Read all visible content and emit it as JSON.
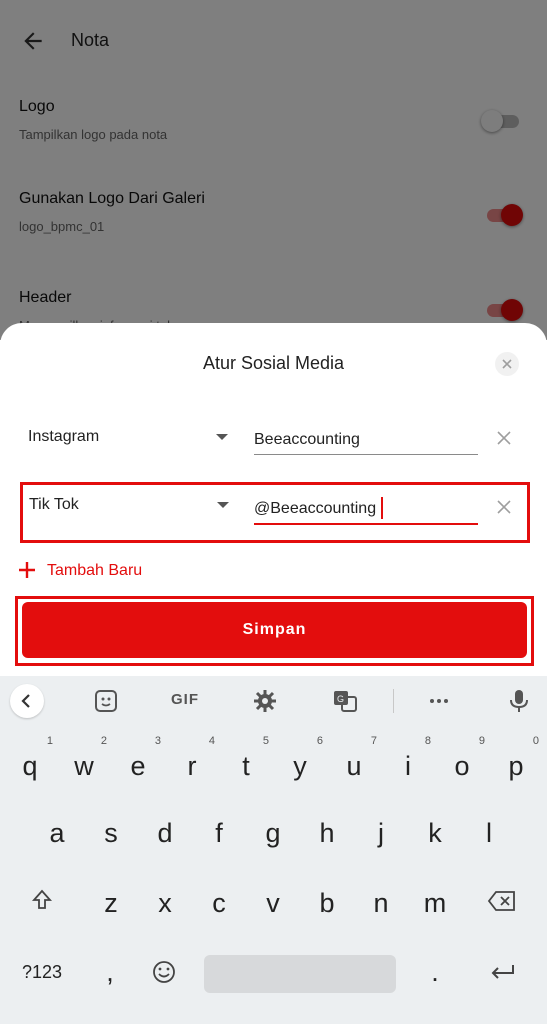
{
  "app": {
    "title": "Nota",
    "settings": [
      {
        "title": "Logo",
        "subtitle": "Tampilkan logo pada nota",
        "enabled": false
      },
      {
        "title": "Gunakan Logo Dari Galeri",
        "subtitle": "logo_bpmc_01",
        "enabled": true
      },
      {
        "title": "Header",
        "subtitle": "Menampilkan informasi toko",
        "enabled": true
      }
    ]
  },
  "sheet": {
    "title": "Atur Sosial Media",
    "rows": [
      {
        "platform": "Instagram",
        "handle": "Beeaccounting"
      },
      {
        "platform": "Tik Tok",
        "handle": "@Beeaccounting"
      }
    ],
    "add_label": "Tambah Baru",
    "save_label": "Simpan"
  },
  "keyboard": {
    "toolbar": [
      "chevron-left-icon",
      "sticker-icon",
      "GIF",
      "gear-icon",
      "translate-icon",
      "more-icon",
      "mic-icon"
    ],
    "gif_label": "GIF",
    "row1": [
      {
        "k": "q",
        "h": "1"
      },
      {
        "k": "w",
        "h": "2"
      },
      {
        "k": "e",
        "h": "3"
      },
      {
        "k": "r",
        "h": "4"
      },
      {
        "k": "t",
        "h": "5"
      },
      {
        "k": "y",
        "h": "6"
      },
      {
        "k": "u",
        "h": "7"
      },
      {
        "k": "i",
        "h": "8"
      },
      {
        "k": "o",
        "h": "9"
      },
      {
        "k": "p",
        "h": "0"
      }
    ],
    "row2": [
      "a",
      "s",
      "d",
      "f",
      "g",
      "h",
      "j",
      "k",
      "l"
    ],
    "row3": [
      "z",
      "x",
      "c",
      "v",
      "b",
      "n",
      "m"
    ],
    "symbols_label": "?123",
    "comma": ",",
    "period": "."
  },
  "colors": {
    "accent": "#e30d0d",
    "keyboard_bg": "#eceff1"
  }
}
